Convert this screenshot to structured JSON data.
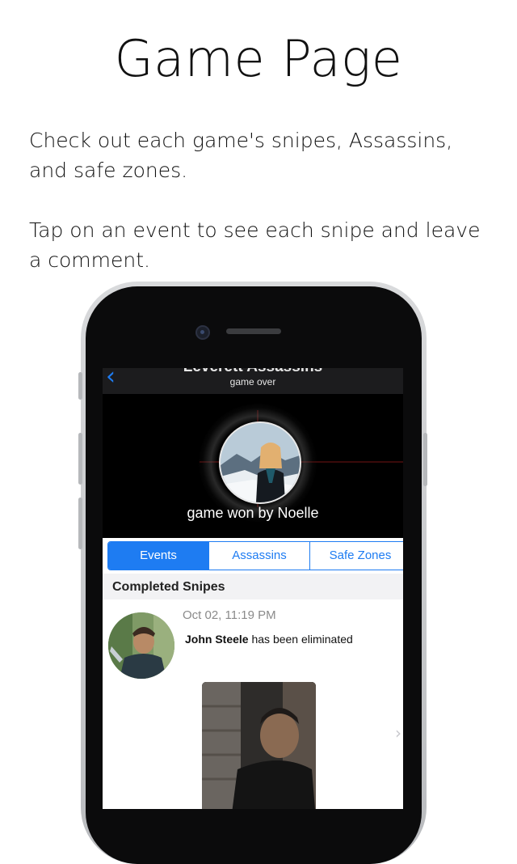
{
  "heading": "Game Page",
  "paragraphs": [
    "Check out each game's snipes, Assassins, and safe zones.",
    "Tap on an event to see each snipe and leave a comment."
  ],
  "app": {
    "nav": {
      "title": "Leverett Assassins",
      "subtitle": "game over",
      "back_icon": "chevron-left-icon"
    },
    "winner_text": "game won by Noelle",
    "tabs": [
      {
        "label": "Events",
        "active": true
      },
      {
        "label": "Assassins",
        "active": false
      },
      {
        "label": "Safe Zones",
        "active": false
      }
    ],
    "section_title": "Completed Snipes",
    "events": [
      {
        "timestamp": "Oct 02, 11:19 PM",
        "name": "John Steele",
        "action": " has been eliminated"
      }
    ]
  },
  "colors": {
    "accent": "#1e7cf2",
    "navbar": "#1c1c1e",
    "hero": "#000000"
  }
}
